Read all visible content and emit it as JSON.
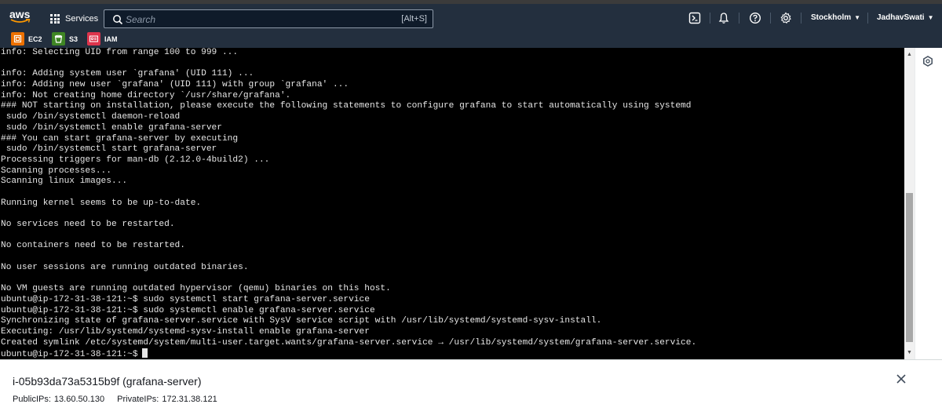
{
  "topnav": {
    "logo_text": "aws",
    "services_label": "Services",
    "search_placeholder": "Search",
    "search_shortcut": "[Alt+S]",
    "region_label": "Stockholm",
    "user_label": "JadhavSwati",
    "icons": [
      "cloudshell-icon",
      "bell-icon",
      "help-icon",
      "gear-icon"
    ]
  },
  "favorites": [
    {
      "label": "EC2",
      "icon": "ec2-icon",
      "color": "#ed7100"
    },
    {
      "label": "S3",
      "icon": "s3-icon",
      "color": "#3f8624"
    },
    {
      "label": "IAM",
      "icon": "iam-icon",
      "color": "#dd344c"
    }
  ],
  "terminal": {
    "lines": [
      "info: Selecting UID from range 100 to 999 ...",
      "",
      "info: Adding system user `grafana' (UID 111) ...",
      "info: Adding new user `grafana' (UID 111) with group `grafana' ...",
      "info: Not creating home directory `/usr/share/grafana'.",
      "### NOT starting on installation, please execute the following statements to configure grafana to start automatically using systemd",
      " sudo /bin/systemctl daemon-reload",
      " sudo /bin/systemctl enable grafana-server",
      "### You can start grafana-server by executing",
      " sudo /bin/systemctl start grafana-server",
      "Processing triggers for man-db (2.12.0-4build2) ...",
      "Scanning processes...",
      "Scanning linux images...",
      "",
      "Running kernel seems to be up-to-date.",
      "",
      "No services need to be restarted.",
      "",
      "No containers need to be restarted.",
      "",
      "No user sessions are running outdated binaries.",
      "",
      "No VM guests are running outdated hypervisor (qemu) binaries on this host.",
      "ubuntu@ip-172-31-38-121:~$ sudo systemctl start grafana-server.service",
      "ubuntu@ip-172-31-38-121:~$ sudo systemctl enable grafana-server.service",
      "Synchronizing state of grafana-server.service with SysV service script with /usr/lib/systemd/systemd-sysv-install.",
      "Executing: /usr/lib/systemd/systemd-sysv-install enable grafana-server",
      "Created symlink /etc/systemd/system/multi-user.target.wants/grafana-server.service → /usr/lib/systemd/system/grafana-server.service."
    ],
    "prompt": "ubuntu@ip-172-31-38-121:~$"
  },
  "instance": {
    "title": "i-05b93da73a5315b9f (grafana-server)",
    "public_ips_label": "PublicIPs:",
    "public_ips_value": "13.60.50.130",
    "private_ips_label": "PrivateIPs:",
    "private_ips_value": "172.31.38.121"
  },
  "colors": {
    "nav_bg": "#232f3e",
    "terminal_bg": "#000000",
    "terminal_fg": "#e6e6e6",
    "aws_smile": "#ff9900"
  }
}
